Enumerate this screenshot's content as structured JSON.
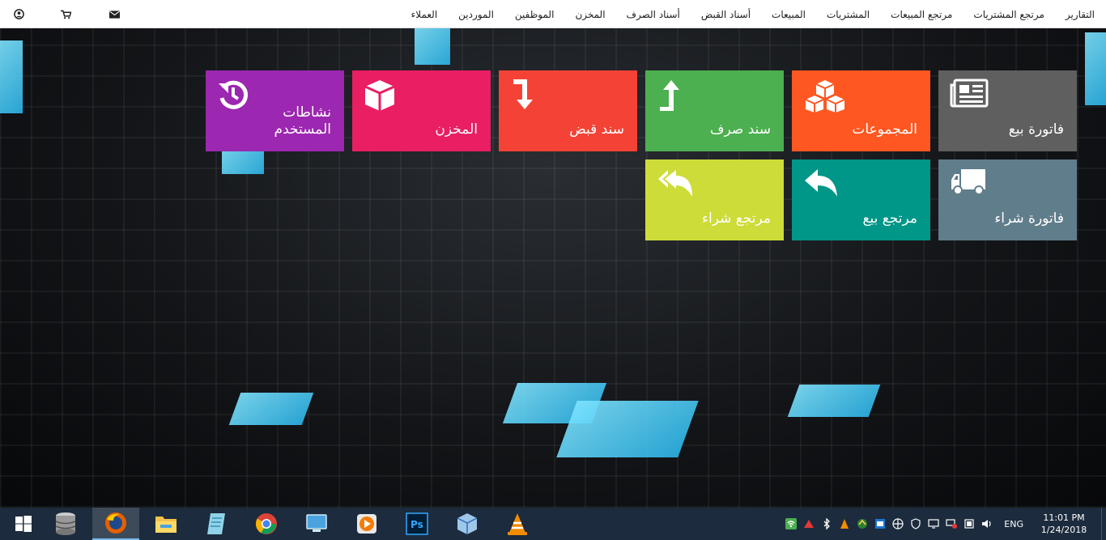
{
  "nav": {
    "menu": [
      "التقارير",
      "مرتجع المشتريات",
      "مرتجع المبيعات",
      "المشتريات",
      "المبيعات",
      "أسناد القبض",
      "أسناد الصرف",
      "المخزن",
      "الموظفين",
      "الموردين",
      "العملاء"
    ],
    "icons": [
      "user-icon",
      "cart-icon",
      "envelope-icon"
    ]
  },
  "tiles": [
    {
      "label": "فاتورة بيع",
      "color": "#5f5f5f",
      "icon": "newspaper-icon"
    },
    {
      "label": "المجموعات",
      "color": "#ff5722",
      "icon": "cubes-icon"
    },
    {
      "label": "سند صرف",
      "color": "#4caf50",
      "icon": "level-up-icon"
    },
    {
      "label": "سند قبض",
      "color": "#f44336",
      "icon": "level-down-icon"
    },
    {
      "label": "المخزن",
      "color": "#e91e63",
      "icon": "cube-icon"
    },
    {
      "label": "نشاطات المستخدم",
      "color": "#9c27b0",
      "icon": "history-icon"
    },
    {
      "label": "فاتورة شراء",
      "color": "#607d8b",
      "icon": "truck-icon"
    },
    {
      "label": "مرتجع بيع",
      "color": "#009688",
      "icon": "reply-icon"
    },
    {
      "label": "مرتجع شراء",
      "color": "#cddc39",
      "icon": "reply-all-icon"
    }
  ],
  "taskbar": {
    "apps": [
      "start-icon",
      "database-icon",
      "firefox-icon",
      "file-explorer-icon",
      "notepad-icon",
      "chrome-icon",
      "virtual-pc-icon",
      "media-player-icon",
      "photoshop-icon",
      "virtualbox-icon",
      "vlc-icon"
    ],
    "lang": "ENG",
    "time": "11:01 PM",
    "date": "1/24/2018"
  }
}
